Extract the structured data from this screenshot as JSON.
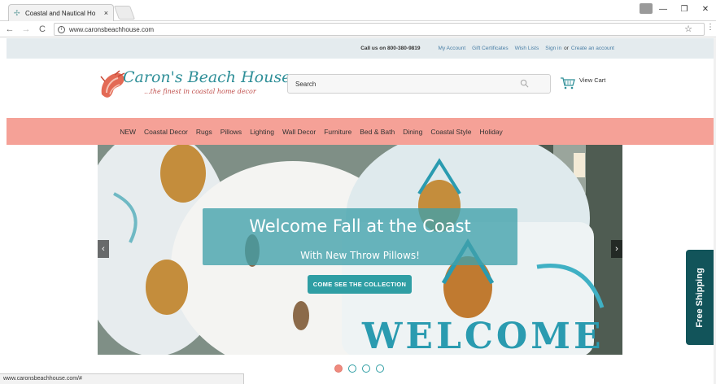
{
  "browser": {
    "tab_title": "Coastal and Nautical Ho",
    "tab_close": "×",
    "url": "www.caronsbeachhouse.com",
    "status_url": "www.caronsbeachhouse.com/#",
    "win_minimize": "—",
    "win_maximize": "❐",
    "win_close": "✕",
    "back": "←",
    "forward": "→",
    "reload": "C",
    "bookmark": "☆",
    "menu": "⋮"
  },
  "topbar": {
    "call": "Call us on 800-380-9819",
    "my_account": "My Account",
    "gift_certificates": "Gift Certificates",
    "wish_lists": "Wish Lists",
    "sign_in": "Sign in",
    "or": "or",
    "create_account": "Create an account"
  },
  "header": {
    "logo_name": "Caron's Beach House",
    "logo_tagline": "...the finest in coastal home decor",
    "search_placeholder": "Search",
    "cart_label": "View Cart"
  },
  "nav": {
    "items": [
      "NEW",
      "Coastal Decor",
      "Rugs",
      "Pillows",
      "Lighting",
      "Wall Decor",
      "Furniture",
      "Bed & Bath",
      "Dining",
      "Coastal Style",
      "Holiday"
    ]
  },
  "hero": {
    "title": "Welcome Fall at the Coast",
    "subtitle": "With New Throw Pillows!",
    "cta": "COME SEE THE COLLECTION",
    "prev": "‹",
    "next": "›",
    "slide_count": 4,
    "active_slide": 1
  },
  "free_shipping": {
    "label": "Free Shipping",
    "close": "✕"
  },
  "colors": {
    "nav_bg": "#f5a197",
    "topbar_bg": "#e4ebee",
    "accent_teal": "#2f9ea4",
    "free_ship_bg": "#12545a"
  }
}
